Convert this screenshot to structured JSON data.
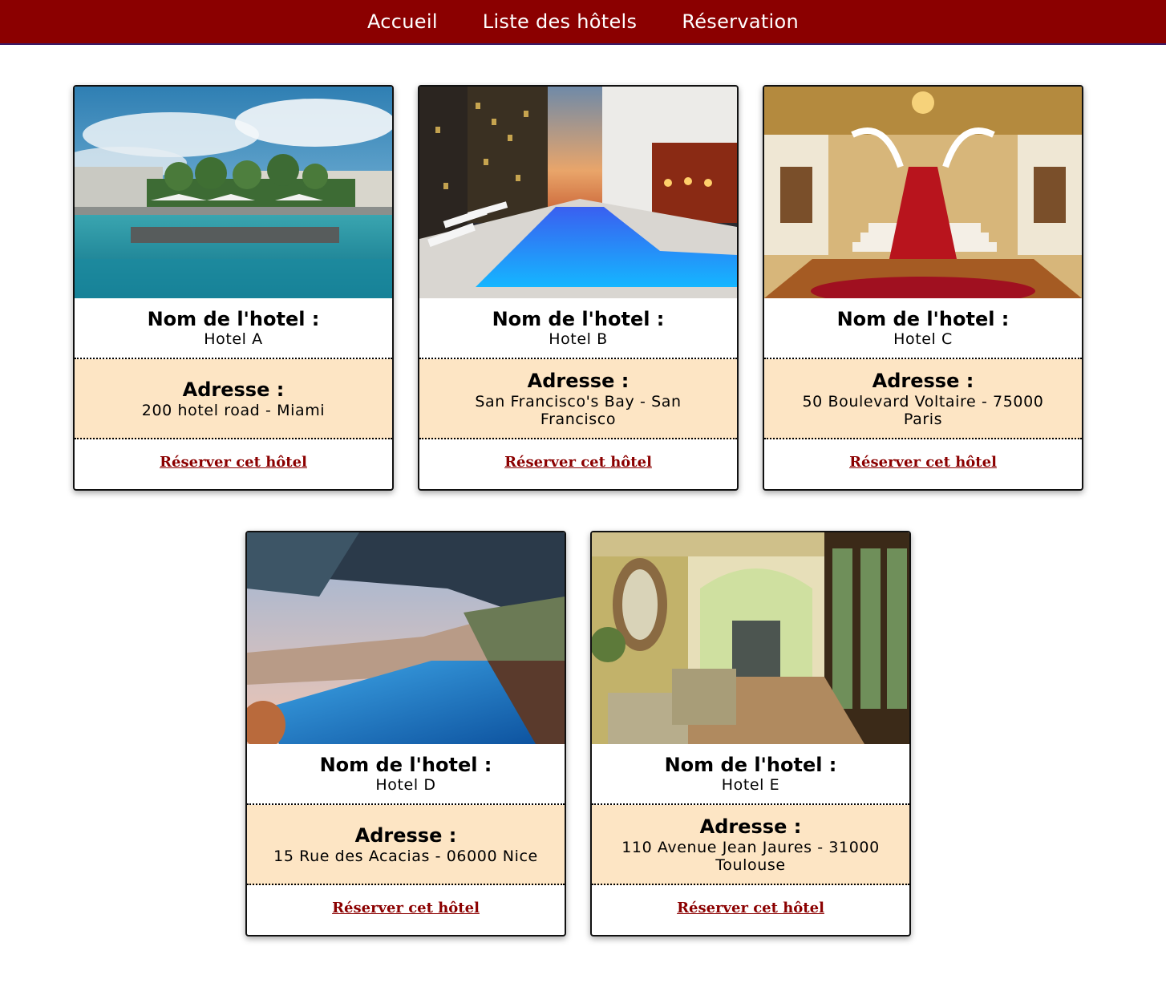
{
  "nav": {
    "items": [
      {
        "label": "Accueil"
      },
      {
        "label": "Liste des hôtels"
      },
      {
        "label": "Réservation"
      }
    ]
  },
  "colors": {
    "nav_bg": "#8b0000",
    "address_bg": "#fde5c4",
    "link": "#8b0000"
  },
  "hotels": [
    {
      "name_label": "Nom de l'hotel :",
      "name": "Hotel A",
      "address_label": "Adresse :",
      "address": "200 hotel road - Miami",
      "link": "Réserver cet hôtel",
      "image": "outdoor-pool-with-umbrellas"
    },
    {
      "name_label": "Nom de l'hotel :",
      "name": "Hotel B",
      "address_label": "Adresse :",
      "address": "San Francisco's Bay - San Francisco",
      "link": "Réserver cet hôtel",
      "image": "city-rooftop-pool-at-sunset"
    },
    {
      "name_label": "Nom de l'hotel :",
      "name": "Hotel C",
      "address_label": "Adresse :",
      "address": "50 Boulevard Voltaire - 75000 Paris",
      "link": "Réserver cet hôtel",
      "image": "grand-staircase-lobby"
    },
    {
      "name_label": "Nom de l'hotel :",
      "name": "Hotel D",
      "address_label": "Adresse :",
      "address": "15 Rue des Acacias - 06000 Nice",
      "link": "Réserver cet hôtel",
      "image": "infinity-pool-hillside-view"
    },
    {
      "name_label": "Nom de l'hotel :",
      "name": "Hotel E",
      "address_label": "Adresse :",
      "address": "110 Avenue Jean Jaures - 31000 Toulouse",
      "link": "Réserver cet hôtel",
      "image": "hallway-with-arches"
    }
  ]
}
